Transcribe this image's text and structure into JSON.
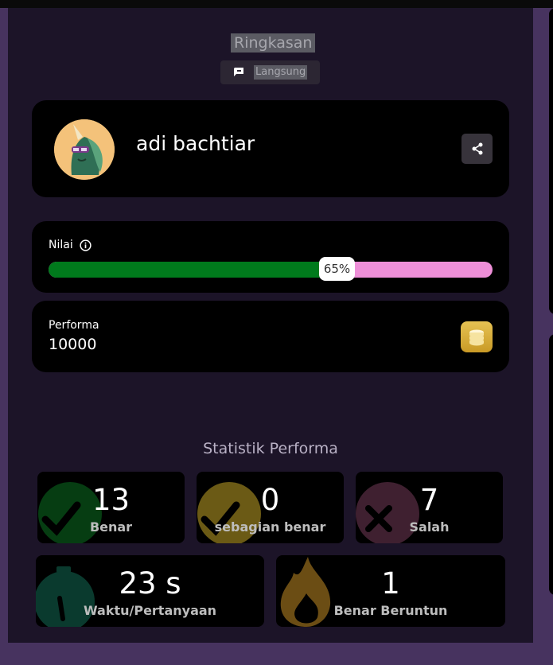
{
  "header": {
    "title": "Ringkasan",
    "mode_label": "Langsung"
  },
  "profile": {
    "name": "adi bachtiar"
  },
  "score": {
    "label": "Nilai",
    "percent_text": "65%",
    "percent": 65,
    "fill_color": "#007a1c",
    "track_color": "#ee8fd8"
  },
  "performance": {
    "label": "Performa",
    "value": "10000"
  },
  "stats": {
    "title": "Statistik Performa",
    "correct": {
      "value": "13",
      "label": "Benar"
    },
    "partial": {
      "value": "0",
      "label": "sebagian benar"
    },
    "wrong": {
      "value": "7",
      "label": "Salah"
    },
    "time": {
      "value": "23 s",
      "label": "Waktu/Pertanyaan"
    },
    "streak": {
      "value": "1",
      "label": "Benar Beruntun"
    }
  }
}
